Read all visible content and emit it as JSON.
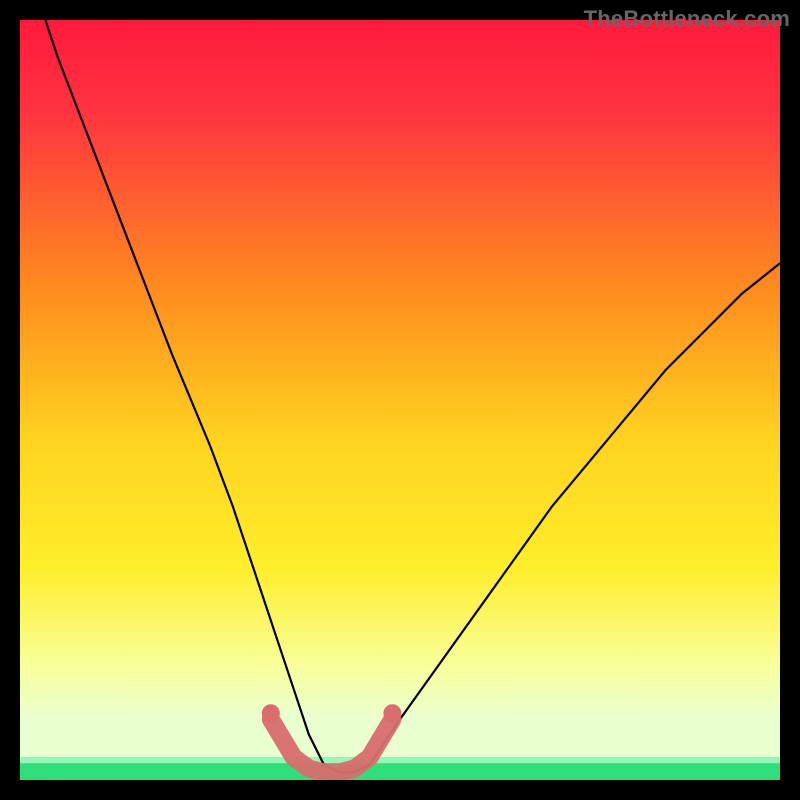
{
  "watermark": "TheBottleneck.com",
  "colors": {
    "bg": "#000000",
    "curve": "#000000",
    "marker": "#d96d6d",
    "marker_stroke": "#d96d6d",
    "green": "#2fe07a",
    "gradient_top": "#ff0033",
    "gradient_mid": "#ffb000",
    "gradient_yellow": "#ffee00",
    "gradient_pale": "#f8ffcc"
  },
  "chart_data": {
    "type": "line",
    "title": "",
    "xlabel": "",
    "ylabel": "",
    "xlim": [
      0,
      100
    ],
    "ylim": [
      0,
      100
    ],
    "curve": {
      "x": [
        0,
        5,
        10,
        15,
        20,
        25,
        28,
        30,
        32,
        34,
        36,
        38,
        40,
        42,
        44,
        46,
        50,
        55,
        60,
        65,
        70,
        75,
        80,
        85,
        90,
        95,
        100
      ],
      "y": [
        110,
        95,
        82,
        69,
        56,
        44,
        36,
        30,
        24,
        18,
        12,
        6,
        2,
        1,
        1,
        2,
        8,
        15,
        22,
        29,
        36,
        42,
        48,
        54,
        59,
        64,
        68
      ]
    },
    "markers": {
      "x": [
        33,
        36,
        38,
        40,
        42,
        44,
        46,
        49
      ],
      "y": [
        8,
        3,
        1.5,
        1,
        1,
        1.5,
        3,
        8
      ]
    },
    "green_band": {
      "y0": 0,
      "y1": 3
    }
  }
}
